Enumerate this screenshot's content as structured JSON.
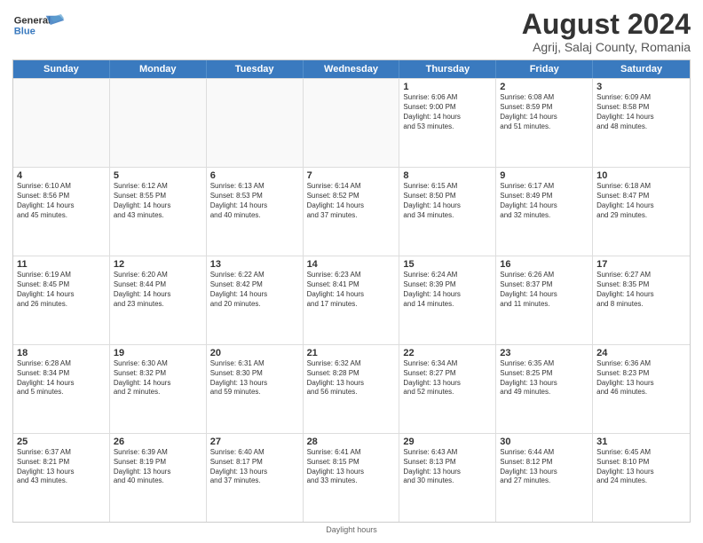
{
  "header": {
    "logo_general": "General",
    "logo_blue": "Blue",
    "main_title": "August 2024",
    "sub_title": "Agrij, Salaj County, Romania"
  },
  "calendar": {
    "days_of_week": [
      "Sunday",
      "Monday",
      "Tuesday",
      "Wednesday",
      "Thursday",
      "Friday",
      "Saturday"
    ],
    "rows": [
      [
        {
          "day": "",
          "empty": true,
          "info": ""
        },
        {
          "day": "",
          "empty": true,
          "info": ""
        },
        {
          "day": "",
          "empty": true,
          "info": ""
        },
        {
          "day": "",
          "empty": true,
          "info": ""
        },
        {
          "day": "1",
          "empty": false,
          "info": "Sunrise: 6:06 AM\nSunset: 9:00 PM\nDaylight: 14 hours\nand 53 minutes."
        },
        {
          "day": "2",
          "empty": false,
          "info": "Sunrise: 6:08 AM\nSunset: 8:59 PM\nDaylight: 14 hours\nand 51 minutes."
        },
        {
          "day": "3",
          "empty": false,
          "info": "Sunrise: 6:09 AM\nSunset: 8:58 PM\nDaylight: 14 hours\nand 48 minutes."
        }
      ],
      [
        {
          "day": "4",
          "empty": false,
          "info": "Sunrise: 6:10 AM\nSunset: 8:56 PM\nDaylight: 14 hours\nand 45 minutes."
        },
        {
          "day": "5",
          "empty": false,
          "info": "Sunrise: 6:12 AM\nSunset: 8:55 PM\nDaylight: 14 hours\nand 43 minutes."
        },
        {
          "day": "6",
          "empty": false,
          "info": "Sunrise: 6:13 AM\nSunset: 8:53 PM\nDaylight: 14 hours\nand 40 minutes."
        },
        {
          "day": "7",
          "empty": false,
          "info": "Sunrise: 6:14 AM\nSunset: 8:52 PM\nDaylight: 14 hours\nand 37 minutes."
        },
        {
          "day": "8",
          "empty": false,
          "info": "Sunrise: 6:15 AM\nSunset: 8:50 PM\nDaylight: 14 hours\nand 34 minutes."
        },
        {
          "day": "9",
          "empty": false,
          "info": "Sunrise: 6:17 AM\nSunset: 8:49 PM\nDaylight: 14 hours\nand 32 minutes."
        },
        {
          "day": "10",
          "empty": false,
          "info": "Sunrise: 6:18 AM\nSunset: 8:47 PM\nDaylight: 14 hours\nand 29 minutes."
        }
      ],
      [
        {
          "day": "11",
          "empty": false,
          "info": "Sunrise: 6:19 AM\nSunset: 8:45 PM\nDaylight: 14 hours\nand 26 minutes."
        },
        {
          "day": "12",
          "empty": false,
          "info": "Sunrise: 6:20 AM\nSunset: 8:44 PM\nDaylight: 14 hours\nand 23 minutes."
        },
        {
          "day": "13",
          "empty": false,
          "info": "Sunrise: 6:22 AM\nSunset: 8:42 PM\nDaylight: 14 hours\nand 20 minutes."
        },
        {
          "day": "14",
          "empty": false,
          "info": "Sunrise: 6:23 AM\nSunset: 8:41 PM\nDaylight: 14 hours\nand 17 minutes."
        },
        {
          "day": "15",
          "empty": false,
          "info": "Sunrise: 6:24 AM\nSunset: 8:39 PM\nDaylight: 14 hours\nand 14 minutes."
        },
        {
          "day": "16",
          "empty": false,
          "info": "Sunrise: 6:26 AM\nSunset: 8:37 PM\nDaylight: 14 hours\nand 11 minutes."
        },
        {
          "day": "17",
          "empty": false,
          "info": "Sunrise: 6:27 AM\nSunset: 8:35 PM\nDaylight: 14 hours\nand 8 minutes."
        }
      ],
      [
        {
          "day": "18",
          "empty": false,
          "info": "Sunrise: 6:28 AM\nSunset: 8:34 PM\nDaylight: 14 hours\nand 5 minutes."
        },
        {
          "day": "19",
          "empty": false,
          "info": "Sunrise: 6:30 AM\nSunset: 8:32 PM\nDaylight: 14 hours\nand 2 minutes."
        },
        {
          "day": "20",
          "empty": false,
          "info": "Sunrise: 6:31 AM\nSunset: 8:30 PM\nDaylight: 13 hours\nand 59 minutes."
        },
        {
          "day": "21",
          "empty": false,
          "info": "Sunrise: 6:32 AM\nSunset: 8:28 PM\nDaylight: 13 hours\nand 56 minutes."
        },
        {
          "day": "22",
          "empty": false,
          "info": "Sunrise: 6:34 AM\nSunset: 8:27 PM\nDaylight: 13 hours\nand 52 minutes."
        },
        {
          "day": "23",
          "empty": false,
          "info": "Sunrise: 6:35 AM\nSunset: 8:25 PM\nDaylight: 13 hours\nand 49 minutes."
        },
        {
          "day": "24",
          "empty": false,
          "info": "Sunrise: 6:36 AM\nSunset: 8:23 PM\nDaylight: 13 hours\nand 46 minutes."
        }
      ],
      [
        {
          "day": "25",
          "empty": false,
          "info": "Sunrise: 6:37 AM\nSunset: 8:21 PM\nDaylight: 13 hours\nand 43 minutes."
        },
        {
          "day": "26",
          "empty": false,
          "info": "Sunrise: 6:39 AM\nSunset: 8:19 PM\nDaylight: 13 hours\nand 40 minutes."
        },
        {
          "day": "27",
          "empty": false,
          "info": "Sunrise: 6:40 AM\nSunset: 8:17 PM\nDaylight: 13 hours\nand 37 minutes."
        },
        {
          "day": "28",
          "empty": false,
          "info": "Sunrise: 6:41 AM\nSunset: 8:15 PM\nDaylight: 13 hours\nand 33 minutes."
        },
        {
          "day": "29",
          "empty": false,
          "info": "Sunrise: 6:43 AM\nSunset: 8:13 PM\nDaylight: 13 hours\nand 30 minutes."
        },
        {
          "day": "30",
          "empty": false,
          "info": "Sunrise: 6:44 AM\nSunset: 8:12 PM\nDaylight: 13 hours\nand 27 minutes."
        },
        {
          "day": "31",
          "empty": false,
          "info": "Sunrise: 6:45 AM\nSunset: 8:10 PM\nDaylight: 13 hours\nand 24 minutes."
        }
      ]
    ]
  },
  "footer": {
    "note": "Daylight hours"
  }
}
